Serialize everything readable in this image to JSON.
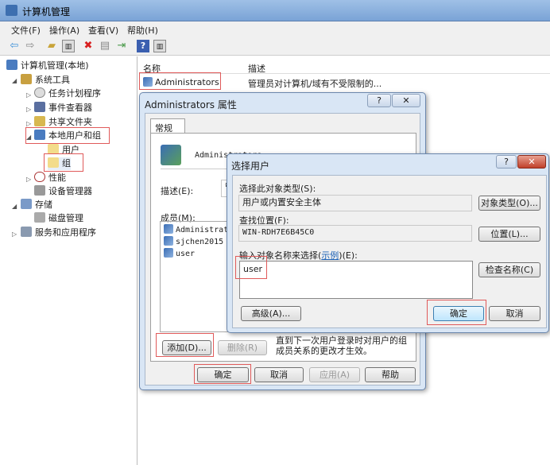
{
  "window": {
    "title": "计算机管理"
  },
  "menu": [
    "文件(F)",
    "操作(A)",
    "查看(V)",
    "帮助(H)"
  ],
  "tree": {
    "root": "计算机管理(本地)",
    "system_tools": "系统工具",
    "task_scheduler": "任务计划程序",
    "event_viewer": "事件查看器",
    "shared_folders": "共享文件夹",
    "local_users_groups": "本地用户和组",
    "users": "用户",
    "groups": "组",
    "performance": "性能",
    "device_manager": "设备管理器",
    "storage": "存储",
    "disk_management": "磁盘管理",
    "services_apps": "服务和应用程序"
  },
  "list": {
    "col_name": "名称",
    "col_desc": "描述",
    "rows": [
      {
        "name": "Administrators",
        "desc": "管理员对计算机/域有不受限制的..."
      }
    ]
  },
  "props": {
    "title": "Administrators 属性",
    "tab": "常规",
    "group_name": "Administrators",
    "desc_label": "描述(E):",
    "desc_value": "管",
    "members_label": "成员(M):",
    "members": [
      "Administrators",
      "sjchen2015",
      "user"
    ],
    "add": "添加(D)...",
    "remove": "删除(R)",
    "note": "直到下一次用户登录时对用户的组成员关系的更改才生效。",
    "ok": "确定",
    "cancel": "取消",
    "apply": "应用(A)",
    "help": "帮助"
  },
  "select": {
    "title": "选择用户",
    "type_label": "选择此对象类型(S):",
    "type_value": "用户或内置安全主体",
    "type_btn": "对象类型(O)...",
    "loc_label": "查找位置(F):",
    "loc_value": "WIN-RDH7E6B45C0",
    "loc_btn": "位置(L)...",
    "name_label_pre": "输入对象名称来选择(",
    "name_label_link": "示例",
    "name_label_post": ")(E):",
    "name_value": "user",
    "check_btn": "检查名称(C)",
    "advanced": "高级(A)...",
    "ok": "确定",
    "cancel": "取消"
  }
}
